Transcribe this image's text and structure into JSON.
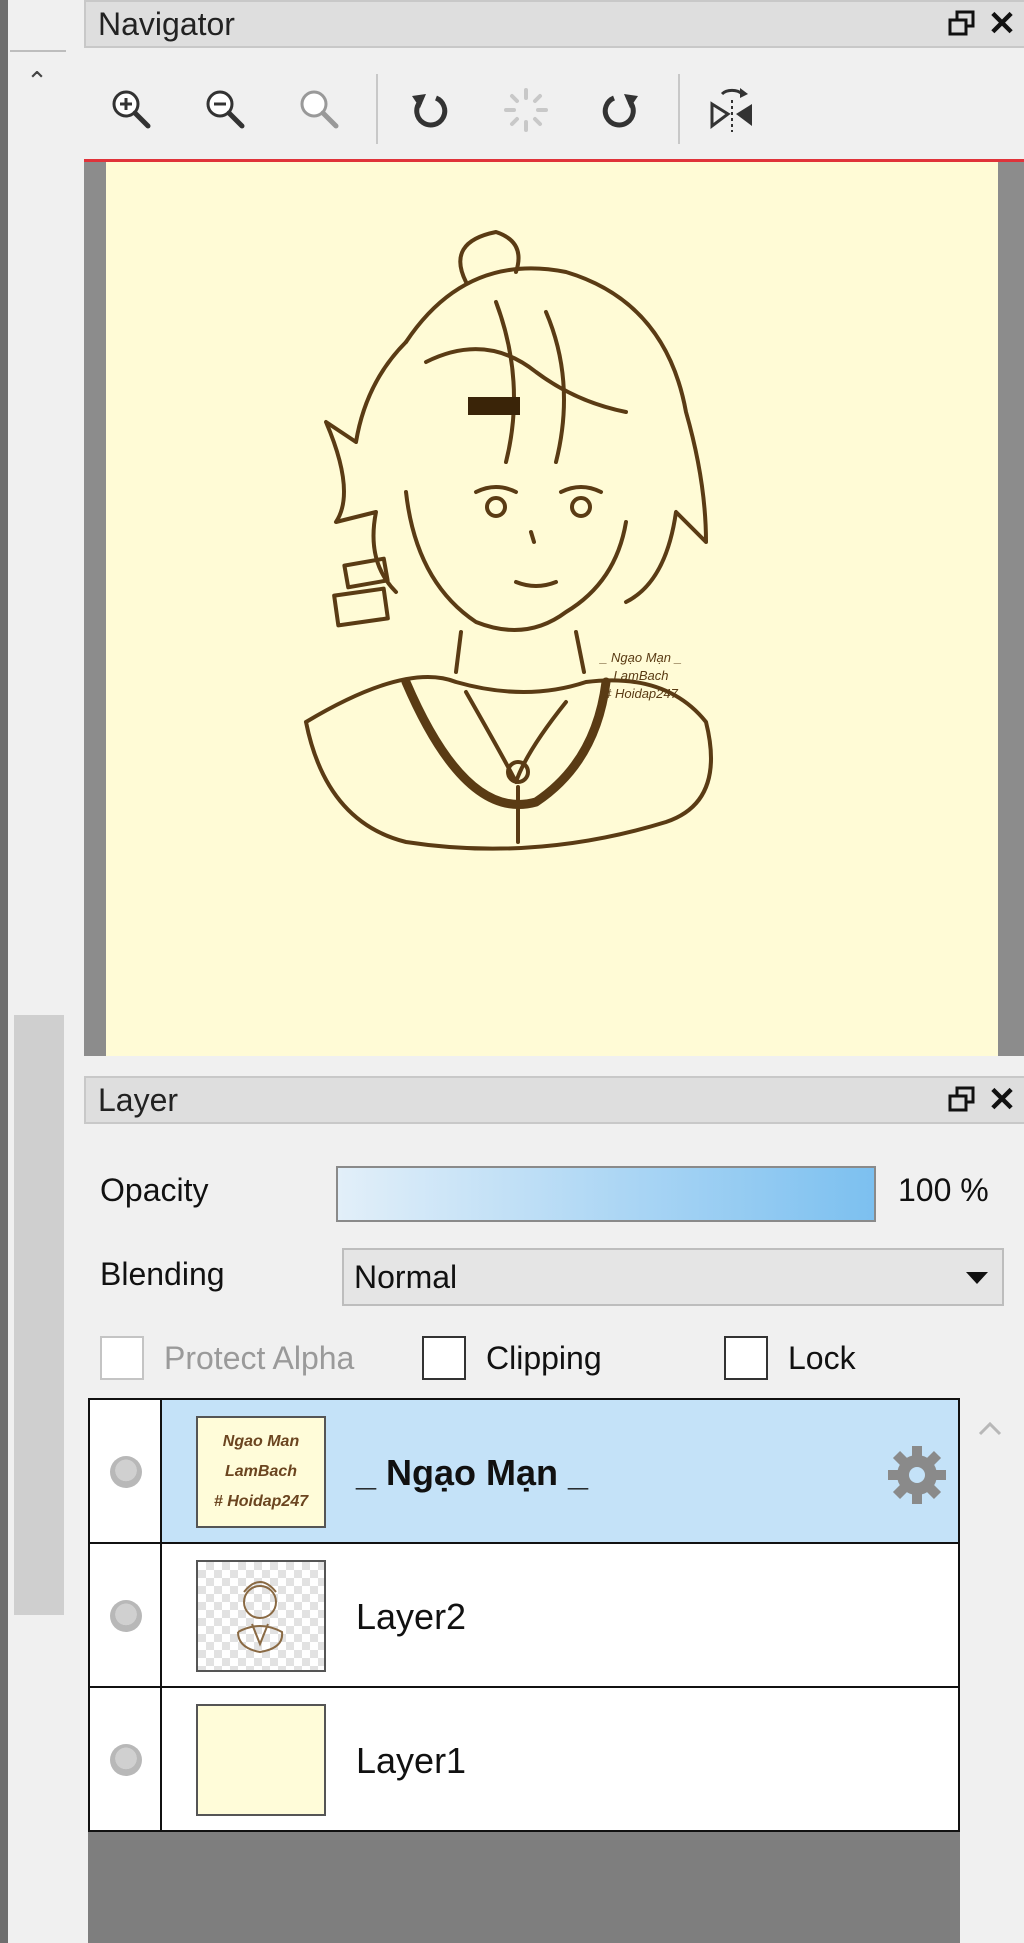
{
  "navigator": {
    "title": "Navigator",
    "tools": [
      "zoom-in-icon",
      "zoom-out-icon",
      "zoom-reset-icon",
      "rotate-left-icon",
      "rotate-reset-icon",
      "rotate-right-icon",
      "flip-horizontal-icon"
    ],
    "canvas_watermark": [
      "_ Ngạo Mạn _",
      "LamBach",
      "# Hoidap247"
    ]
  },
  "layer_panel": {
    "title": "Layer",
    "opacity_label": "Opacity",
    "opacity_value": "100 %",
    "opacity_fraction": 1.0,
    "blending_label": "Blending",
    "blending_value": "Normal",
    "protect_alpha_label": "Protect Alpha",
    "clipping_label": "Clipping",
    "lock_label": "Lock",
    "layers": [
      {
        "name": "_ Ngạo Mạn _",
        "selected": true,
        "thumb_text": [
          "Ngao Man",
          "LamBach",
          "# Hoidap247"
        ]
      },
      {
        "name": "Layer2",
        "selected": false
      },
      {
        "name": "Layer1",
        "selected": false
      }
    ]
  },
  "colors": {
    "accent_red": "#e0333a",
    "selected_row": "#c4e2f8",
    "canvas_bg": "#fffbd6",
    "line_art": "#5a3b14"
  }
}
